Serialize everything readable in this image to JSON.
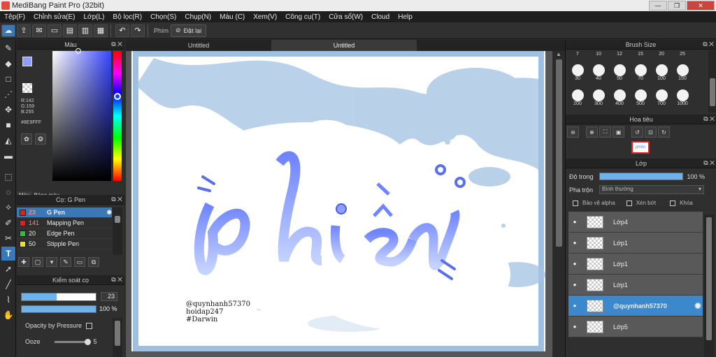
{
  "window": {
    "title": "MediBang Paint Pro (32bit)",
    "min": "—",
    "max": "❐",
    "close": "✕"
  },
  "menu": [
    "Tệp(F)",
    "Chỉnh sửa(E)",
    "Lớp(L)",
    "Bộ lọc(R)",
    "Chọn(S)",
    "Chụp(N)",
    "Màu (C)",
    "Xem(V)",
    "Công cụ(T)",
    "Cửa sổ(W)",
    "Cloud",
    "Help"
  ],
  "toolbar": {
    "label": "Phím",
    "reset": "Đặt lại"
  },
  "color_panel": {
    "title": "Màu",
    "r": "R:142",
    "g": "G:159",
    "b": "B:255",
    "hex": "#8E9FFF",
    "tab1": "Màu",
    "tab2": "Bảng màu",
    "fore_color": "#8e9fff",
    "back_color": "#e03030"
  },
  "brush_panel": {
    "title": "Cọ: G Pen",
    "items": [
      {
        "num": "23",
        "name": "G Pen",
        "color": "#e02020"
      },
      {
        "num": "141",
        "name": "Mapping Pen",
        "color": "#e02020"
      },
      {
        "num": "20",
        "name": "Edge Pen",
        "color": "#30c030"
      },
      {
        "num": "50",
        "name": "Stipple Pen",
        "color": "#f0e020"
      }
    ]
  },
  "brush_control": {
    "title": "Kiểm soát cọ",
    "size": "23",
    "opacity": "100 %",
    "opacity_pressure": "Opacity by Pressure",
    "ooze_label": "Ooze",
    "ooze_value": "5"
  },
  "tabs": [
    "Untitled",
    "Untitled"
  ],
  "canvas": {
    "word": "phiền",
    "credit1": "@quynhanh57370",
    "credit2": "hoidap247",
    "credit3": "#Darwin"
  },
  "brush_size": {
    "title": "Brush Size",
    "row1": [
      "7",
      "10",
      "12",
      "15",
      "20",
      "25"
    ],
    "row2": [
      "30",
      "40",
      "50",
      "70",
      "100",
      "150"
    ],
    "row3": [
      "200",
      "300",
      "400",
      "500",
      "700",
      "1000"
    ]
  },
  "navigator": {
    "title": "Hoa tiêu"
  },
  "layer_panel": {
    "title": "Lớp",
    "opacity_label": "Độ trong",
    "opacity_value": "100 %",
    "blend_label": "Pha trộn",
    "blend_value": "Bình thường",
    "protect_alpha": "Bảo vệ alpha",
    "clip": "Xén bớt",
    "lock": "Khóa",
    "layers": [
      "Lớp4",
      "Lớp1",
      "Lớp1",
      "Lớp1",
      "@quynhanh57370",
      "Lớp5"
    ]
  }
}
